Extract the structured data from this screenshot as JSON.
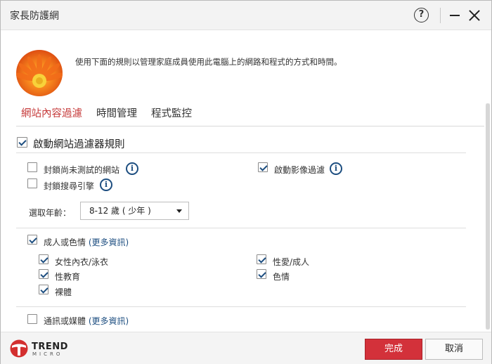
{
  "window": {
    "title": "家長防護網"
  },
  "header": {
    "intro": "使用下面的規則以管理家庭成員使用此電腦上的網路和程式的方式和時間。"
  },
  "tabs": [
    {
      "label": "網站內容過濾",
      "active": true
    },
    {
      "label": "時間管理",
      "active": false
    },
    {
      "label": "程式監控",
      "active": false
    }
  ],
  "filter": {
    "enable_label": "啟動網站過濾器規則",
    "enable_checked": true,
    "block_untested_label": "封鎖尚未測試的網站",
    "block_untested_checked": false,
    "block_search_label": "封鎖搜尋引擎",
    "block_search_checked": false,
    "image_filter_label": "啟動影像過濾",
    "image_filter_checked": true,
    "age_label": "選取年齡：",
    "age_value": "8-12 歲 ( 少年 )"
  },
  "categories": {
    "adult": {
      "label": "成人或色情",
      "more_info": "(更多資訊)",
      "checked": true,
      "items": [
        {
          "label": "女性內衣/泳衣",
          "checked": true
        },
        {
          "label": "性愛/成人",
          "checked": true
        },
        {
          "label": "性教育",
          "checked": true
        },
        {
          "label": "色情",
          "checked": true
        },
        {
          "label": "裸體",
          "checked": true
        }
      ]
    },
    "comm": {
      "label": "通訊或媒體",
      "more_info": "(更多資訊)",
      "checked": false
    }
  },
  "footer": {
    "logo_line1": "TREND",
    "logo_line2": "MICRO",
    "done_label": "完成",
    "cancel_label": "取消"
  },
  "colors": {
    "active_tab": "#c63b3b",
    "link": "#1d4e80",
    "primary_button": "#d3313a"
  }
}
